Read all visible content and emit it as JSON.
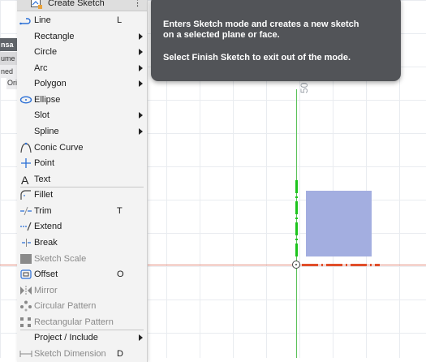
{
  "strip_tabs": [
    "nsa",
    "ume",
    "ned",
    "Ori"
  ],
  "menu": {
    "header_label": "Create Sketch",
    "items": [
      {
        "label": "Line",
        "shortcut": "L",
        "icon": "line-icon",
        "submenu": false,
        "disabled": false
      },
      {
        "label": "Rectangle",
        "shortcut": "",
        "icon": "",
        "submenu": true,
        "disabled": false
      },
      {
        "label": "Circle",
        "shortcut": "",
        "icon": "",
        "submenu": true,
        "disabled": false
      },
      {
        "label": "Arc",
        "shortcut": "",
        "icon": "",
        "submenu": true,
        "disabled": false
      },
      {
        "label": "Polygon",
        "shortcut": "",
        "icon": "",
        "submenu": true,
        "disabled": false
      },
      {
        "label": "Ellipse",
        "shortcut": "",
        "icon": "ellipse-icon",
        "submenu": false,
        "disabled": false
      },
      {
        "label": "Slot",
        "shortcut": "",
        "icon": "",
        "submenu": true,
        "disabled": false
      },
      {
        "label": "Spline",
        "shortcut": "",
        "icon": "",
        "submenu": true,
        "disabled": false
      },
      {
        "label": "Conic Curve",
        "shortcut": "",
        "icon": "conic-curve-icon",
        "submenu": false,
        "disabled": false
      },
      {
        "label": "Point",
        "shortcut": "",
        "icon": "point-icon",
        "submenu": false,
        "disabled": false
      },
      {
        "label": "Text",
        "shortcut": "",
        "icon": "text-icon",
        "submenu": false,
        "disabled": false
      },
      {
        "label": "Fillet",
        "shortcut": "",
        "icon": "fillet-icon",
        "submenu": false,
        "disabled": false
      },
      {
        "label": "Trim",
        "shortcut": "T",
        "icon": "trim-icon",
        "submenu": false,
        "disabled": false
      },
      {
        "label": "Extend",
        "shortcut": "",
        "icon": "extend-icon",
        "submenu": false,
        "disabled": false
      },
      {
        "label": "Break",
        "shortcut": "",
        "icon": "break-icon",
        "submenu": false,
        "disabled": false
      },
      {
        "label": "Sketch Scale",
        "shortcut": "",
        "icon": "sketch-scale-icon",
        "submenu": false,
        "disabled": true
      },
      {
        "label": "Offset",
        "shortcut": "O",
        "icon": "offset-icon",
        "submenu": false,
        "disabled": false
      },
      {
        "label": "Mirror",
        "shortcut": "",
        "icon": "mirror-icon",
        "submenu": false,
        "disabled": true
      },
      {
        "label": "Circular Pattern",
        "shortcut": "",
        "icon": "circular-pattern-icon",
        "submenu": false,
        "disabled": true
      },
      {
        "label": "Rectangular Pattern",
        "shortcut": "",
        "icon": "rectangular-pattern-icon",
        "submenu": false,
        "disabled": true
      },
      {
        "label": "Project / Include",
        "shortcut": "",
        "icon": "",
        "submenu": true,
        "disabled": false
      },
      {
        "label": "Sketch Dimension",
        "shortcut": "D",
        "icon": "sketch-dimension-icon",
        "submenu": false,
        "disabled": true
      }
    ]
  },
  "tooltip": {
    "line1": "Enters Sketch mode and creates a new sketch",
    "line2": "on a selected plane or face.",
    "line3": "Select Finish Sketch to exit out of the mode."
  },
  "canvas": {
    "ruler_label": "50",
    "colors": {
      "x_axis": "#e38a7a",
      "y_axis": "#5ac25a",
      "profile": "#a3aee0",
      "dash_red": "#e14e2a",
      "dash_green": "#1cc41c"
    }
  }
}
